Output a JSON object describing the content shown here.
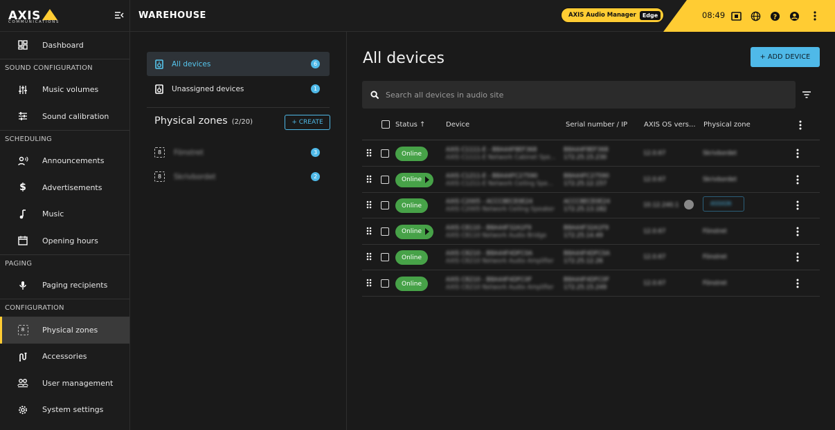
{
  "brand": {
    "name": "AXIS",
    "sub": "COMMUNICATIONS"
  },
  "topbar": {
    "site": "WAREHOUSE",
    "app_badge": "AXIS Audio Manager",
    "edge_badge": "Edge",
    "time": "08:49"
  },
  "sidebar": {
    "items": [
      {
        "label": "Dashboard",
        "icon": "dashboard-icon"
      },
      {
        "section": "SOUND CONFIGURATION"
      },
      {
        "label": "Music volumes",
        "icon": "sliders-icon"
      },
      {
        "label": "Sound calibration",
        "icon": "equalizer-icon"
      },
      {
        "section": "SCHEDULING"
      },
      {
        "label": "Announcements",
        "icon": "announcement-icon"
      },
      {
        "label": "Advertisements",
        "icon": "dollar-icon"
      },
      {
        "label": "Music",
        "icon": "music-note-icon"
      },
      {
        "label": "Opening hours",
        "icon": "calendar-icon"
      },
      {
        "section": "PAGING"
      },
      {
        "label": "Paging recipients",
        "icon": "microphone-icon"
      },
      {
        "section": "CONFIGURATION"
      },
      {
        "label": "Physical zones",
        "icon": "zone-icon",
        "active": true
      },
      {
        "label": "Accessories",
        "icon": "accessories-icon"
      },
      {
        "label": "User management",
        "icon": "users-icon"
      },
      {
        "label": "System settings",
        "icon": "settings-icon"
      }
    ]
  },
  "zones_panel": {
    "all_devices": {
      "label": "All devices",
      "count": "6"
    },
    "unassigned": {
      "label": "Unassigned devices",
      "count": "1"
    },
    "physical_zones_title": "Physical zones",
    "physical_zones_count": "(2/20)",
    "create_label": "+ CREATE",
    "zones": [
      {
        "name": "Fönstret",
        "count": "3"
      },
      {
        "name": "Skrivbordet",
        "count": "2"
      }
    ]
  },
  "main": {
    "title": "All devices",
    "add_device": "+ ADD DEVICE",
    "search_placeholder": "Search all devices in audio site",
    "columns": {
      "status": "Status ↑",
      "device": "Device",
      "serial": "Serial number / IP",
      "os": "AXIS OS vers...",
      "zone": "Physical zone"
    },
    "rows": [
      {
        "status": "Online",
        "arrow": false,
        "device_1": "AXIS C1111-E - B8A44F8EF368",
        "device_2": "AXIS C1111-E Network Cabinet Spe...",
        "serial_1": "B8A44F8EF368",
        "serial_2": "172.25.15.230",
        "os": "12.0.67",
        "zone": "Skrivbordet",
        "assign": false
      },
      {
        "status": "Online",
        "arrow": true,
        "device_1": "AXIS C1211-E - B8A44FC27590",
        "device_2": "AXIS C1211-E Network Ceiling Spe...",
        "serial_1": "B8A44FC27590",
        "serial_2": "172.25.12.157",
        "os": "12.0.67",
        "zone": "Skrivbordet",
        "assign": false
      },
      {
        "status": "Online",
        "arrow": false,
        "device_1": "AXIS C2005 - ACCC8ECE0E24",
        "device_2": "AXIS C2005 Network Ceiling Speaker",
        "serial_1": "ACCC8ECE0E24",
        "serial_2": "172.25.13.182",
        "os": "10.12.240.1",
        "zone": "ASSIGN",
        "assign": true
      },
      {
        "status": "Online",
        "arrow": true,
        "device_1": "AXIS C8110 - B8A44F32A1F9",
        "device_2": "AXIS C8110 Network Audio Bridge",
        "serial_1": "B8A44F32A1F9",
        "serial_2": "172.25.14.49",
        "os": "12.0.67",
        "zone": "Fönstret",
        "assign": false
      },
      {
        "status": "Online",
        "arrow": false,
        "device_1": "AXIS C8210 - B8A44F4DFC0A",
        "device_2": "AXIS C8210 Network Audio Amplifier",
        "serial_1": "B8A44F4DFC0A",
        "serial_2": "172.25.12.26",
        "os": "12.0.67",
        "zone": "Fönstret",
        "assign": false
      },
      {
        "status": "Online",
        "arrow": false,
        "device_1": "AXIS C8210 - B8A44F4DFC0F",
        "device_2": "AXIS C8210 Network Audio Amplifier",
        "serial_1": "B8A44F4DFC0F",
        "serial_2": "172.25.15.249",
        "os": "12.0.67",
        "zone": "Fönstret",
        "assign": false
      }
    ]
  },
  "colors": {
    "accent": "#4fb9e8",
    "brand_yellow": "#ffcc33",
    "online": "#47a248"
  }
}
